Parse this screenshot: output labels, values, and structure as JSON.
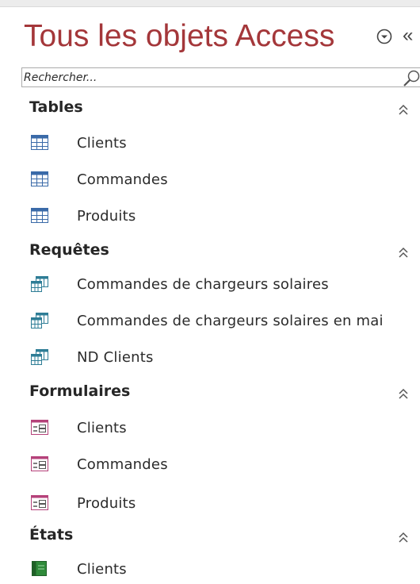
{
  "pane": {
    "title": "Tous les objets Access",
    "search_placeholder": "Rechercher...",
    "icons": {
      "dropdown": "circle-chevron-down-icon",
      "collapse": "double-chevron-left-icon",
      "search": "magnifier-icon"
    },
    "colors": {
      "title": "#a4373a",
      "table_icon": "#3a6aa8",
      "query_icon": "#2e7d96",
      "form_icon": "#b5427a",
      "report_icon": "#2f8a3a"
    }
  },
  "groups": [
    {
      "label": "Tables",
      "items": [
        {
          "label": "Clients"
        },
        {
          "label": "Commandes"
        },
        {
          "label": "Produits"
        }
      ]
    },
    {
      "label": "Requêtes",
      "items": [
        {
          "label": "Commandes de chargeurs solaires"
        },
        {
          "label": "Commandes de chargeurs solaires en mai"
        },
        {
          "label": "ND Clients"
        }
      ]
    },
    {
      "label": "Formulaires",
      "items": [
        {
          "label": "Clients"
        },
        {
          "label": "Commandes"
        },
        {
          "label": "Produits"
        }
      ]
    },
    {
      "label": "États",
      "items": [
        {
          "label": "Clients"
        }
      ]
    }
  ]
}
